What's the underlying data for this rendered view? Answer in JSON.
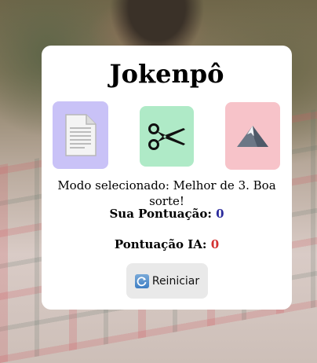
{
  "app": {
    "title": "Jokenpô"
  },
  "choices": [
    {
      "name": "paper",
      "icon": "paper-icon",
      "color": "#c9c2f7"
    },
    {
      "name": "scissors",
      "icon": "scissors-icon",
      "color": "#afeac7"
    },
    {
      "name": "rock",
      "icon": "mountain-icon",
      "color": "#f7c3c9"
    }
  ],
  "status": {
    "mode_text": "Modo selecionado: Melhor de 3. Boa sorte!"
  },
  "scores": {
    "user_label": "Sua Pontuação:",
    "user_value": "0",
    "user_color": "#2b2b9c",
    "ai_label": "Pontuação IA:",
    "ai_value": "0",
    "ai_color": "#d32f2f"
  },
  "controls": {
    "reset_label": "Reiniciar",
    "reset_icon": "refresh-icon"
  }
}
